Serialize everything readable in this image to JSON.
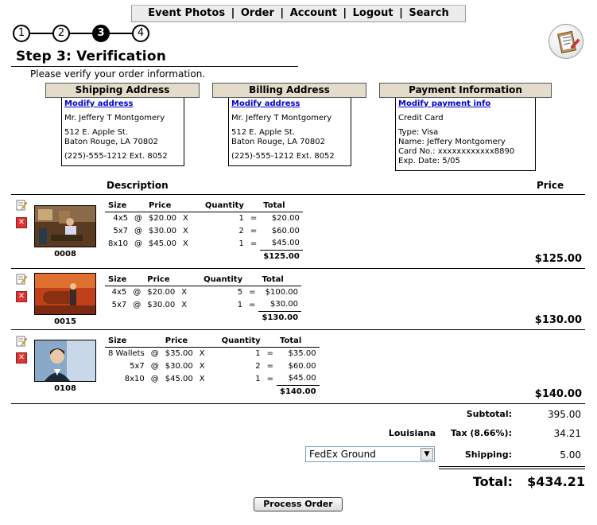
{
  "nav": {
    "items": [
      "Event Photos",
      "Order",
      "Account",
      "Logout",
      "Search"
    ],
    "separator": "|"
  },
  "steps": [
    "1",
    "2",
    "3",
    "4"
  ],
  "active_step": "3",
  "page": {
    "title": "Step 3: Verification",
    "instructions": "Please verify your order information."
  },
  "shipping": {
    "heading": "Shipping Address",
    "link": "Modify address",
    "name": "Mr. Jeffery T Montgomery",
    "street": "512 E. Apple St.",
    "city": "Baton Rouge, LA 70802",
    "phone": "(225)-555-1212 Ext. 8052"
  },
  "billing": {
    "heading": "Billing Address",
    "link": "Modify address",
    "name": "Mr. Jeffery T Montgomery",
    "street": "512 E. Apple St.",
    "city": "Baton Rouge, LA 70802",
    "phone": "(225)-555-1212 Ext. 8052"
  },
  "payment": {
    "heading": "Payment Information",
    "link": "Modify payment info",
    "method": "Credit Card",
    "type": "Type: Visa",
    "name": "Name: Jeffery Montgomery",
    "card": "Card No.: xxxxxxxxxxxx8890",
    "exp": "Exp. Date: 5/05"
  },
  "columns": {
    "description": "Description",
    "price": "Price",
    "size": "Size",
    "unit_price": "Price",
    "quantity": "Quantity",
    "total": "Total"
  },
  "items": [
    {
      "id": "0008",
      "rows": [
        {
          "size": "4x5",
          "at": "@",
          "price": "$20.00",
          "x": "X",
          "qty": "1",
          "eq": "=",
          "total": "$20.00"
        },
        {
          "size": "5x7",
          "at": "@",
          "price": "$30.00",
          "x": "X",
          "qty": "2",
          "eq": "=",
          "total": "$60.00"
        },
        {
          "size": "8x10",
          "at": "@",
          "price": "$45.00",
          "x": "X",
          "qty": "1",
          "eq": "=",
          "total": "$45.00"
        }
      ],
      "subtotal": "$125.00",
      "price": "$125.00"
    },
    {
      "id": "0015",
      "rows": [
        {
          "size": "4x5",
          "at": "@",
          "price": "$20.00",
          "x": "X",
          "qty": "5",
          "eq": "=",
          "total": "$100.00"
        },
        {
          "size": "5x7",
          "at": "@",
          "price": "$30.00",
          "x": "X",
          "qty": "1",
          "eq": "=",
          "total": "$30.00"
        }
      ],
      "subtotal": "$130.00",
      "price": "$130.00"
    },
    {
      "id": "0108",
      "rows": [
        {
          "size": "8 Wallets",
          "at": "@",
          "price": "$35.00",
          "x": "X",
          "qty": "1",
          "eq": "=",
          "total": "$35.00"
        },
        {
          "size": "5x7",
          "at": "@",
          "price": "$30.00",
          "x": "X",
          "qty": "2",
          "eq": "=",
          "total": "$60.00"
        },
        {
          "size": "8x10",
          "at": "@",
          "price": "$45.00",
          "x": "X",
          "qty": "1",
          "eq": "=",
          "total": "$45.00"
        }
      ],
      "subtotal": "$140.00",
      "price": "$140.00"
    }
  ],
  "totals": {
    "subtotal_label": "Subtotal:",
    "subtotal": "395.00",
    "state": "Louisiana",
    "tax_label": "Tax (8.66%):",
    "tax": "34.21",
    "shipping_option": "FedEx Ground",
    "shipping_label": "Shipping:",
    "shipping": "5.00",
    "total_label": "Total:",
    "total": "$434.21"
  },
  "process_button": "Process Order",
  "icons": {
    "edit": "edit-note-icon",
    "delete": "delete-x-icon",
    "clipboard": "clipboard-icon"
  }
}
